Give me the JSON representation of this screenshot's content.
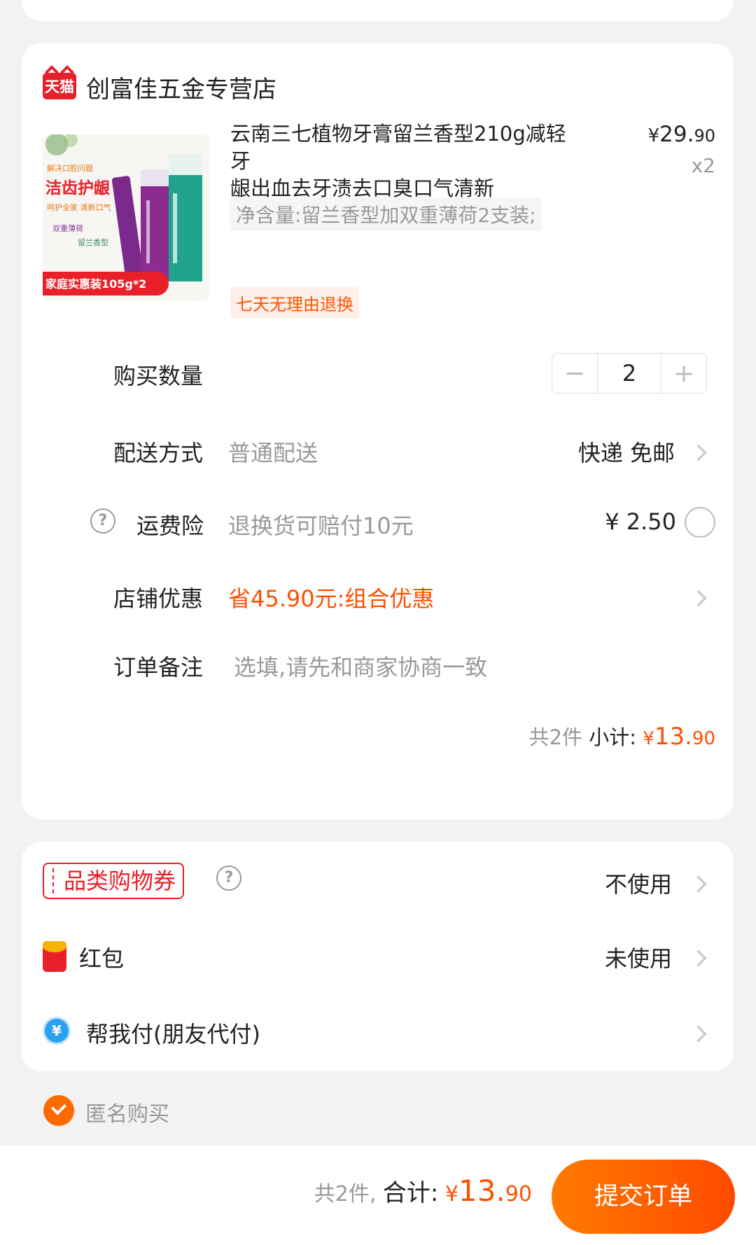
{
  "store": {
    "badge": "天猫",
    "name": "创富佳五金专营店"
  },
  "product": {
    "title_line1": "云南三七植物牙膏留兰香型210g减轻牙",
    "title_line2": "龈出血去牙渍去口臭口气清新",
    "price_currency": "¥",
    "price_int": "29.",
    "price_dec": "90",
    "quantity_label": "x2",
    "spec": "净含量:留兰香型加双重薄荷2支装;",
    "tag": "七天无理由退换",
    "image_text": {
      "top_line": "解决口腔问题",
      "headline": "洁齿护龈",
      "sub": "呵护全家 清新口气",
      "mint": "双重薄荷",
      "flavor": "留兰香型",
      "banner": "家庭实惠装105g*2"
    }
  },
  "rows": {
    "quantity": {
      "label": "购买数量",
      "minus": "−",
      "value": "2",
      "plus": "+"
    },
    "delivery": {
      "label": "配送方式",
      "method": "普通配送",
      "value": "快递 免邮"
    },
    "insurance": {
      "help": "?",
      "label": "运费险",
      "desc": "退换货可赔付10元",
      "value": "¥ 2.50"
    },
    "discount": {
      "label": "店铺优惠",
      "value": "省45.90元:组合优惠"
    },
    "note": {
      "label": "订单备注",
      "placeholder": "选填,请先和商家协商一致"
    }
  },
  "subtotal": {
    "count": "共2件",
    "label": "小计:",
    "currency": "¥",
    "int": "13.",
    "dec": "90"
  },
  "benefits": {
    "coupon": {
      "label": "品类购物券",
      "help": "?",
      "value": "不使用"
    },
    "redpacket": {
      "label": "红包",
      "value": "未使用"
    },
    "friendpay": {
      "icon_char": "¥",
      "label": "帮我付(朋友代付)"
    }
  },
  "anonymous": {
    "label": "匿名购买"
  },
  "footer": {
    "count": "共2件,",
    "total_label": "合计:",
    "currency": "¥",
    "int": "13.",
    "dec": "90",
    "submit": "提交订单"
  },
  "colors": {
    "accent": "#ff5000",
    "tmall_red": "#e8202a",
    "background": "#f2f2f2"
  }
}
